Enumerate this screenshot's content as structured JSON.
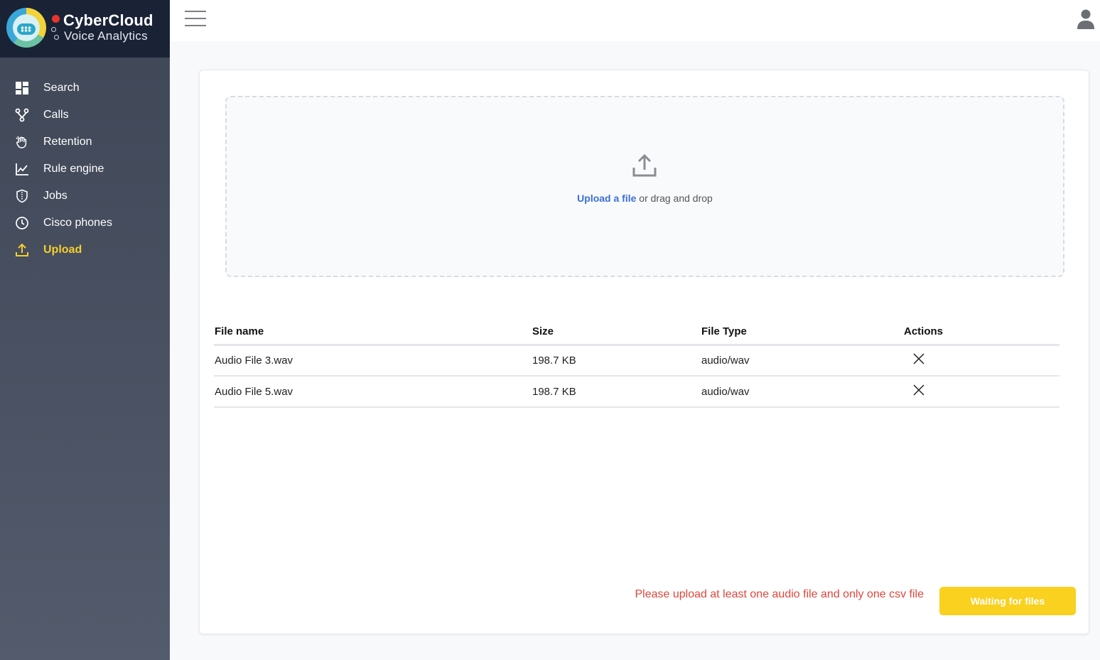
{
  "brand": {
    "title": "CyberCloud",
    "subtitle": "Voice Analytics"
  },
  "nav": [
    {
      "label": "Search",
      "icon": "dashboard-icon",
      "active": false
    },
    {
      "label": "Calls",
      "icon": "branch-icon",
      "active": false
    },
    {
      "label": "Retention",
      "icon": "hand-icon",
      "active": false
    },
    {
      "label": "Rule engine",
      "icon": "chart-line-icon",
      "active": false
    },
    {
      "label": "Jobs",
      "icon": "shield-icon",
      "active": false
    },
    {
      "label": "Cisco phones",
      "icon": "clock-icon",
      "active": false
    },
    {
      "label": "Upload",
      "icon": "upload-icon",
      "active": true
    }
  ],
  "colors": {
    "accent": "#f5cf2a",
    "link": "#3b6fd8",
    "error": "#e0463c",
    "button": "#f9d11e",
    "sidebar_top": "#1a2236"
  },
  "dropzone": {
    "link_text": "Upload a file",
    "rest_text": " or drag and drop"
  },
  "table": {
    "headers": [
      "File name",
      "Size",
      "File Type",
      "Actions"
    ],
    "rows": [
      {
        "name": "Audio File 3.wav",
        "size": "198.7 KB",
        "type": "audio/wav"
      },
      {
        "name": "Audio File 5.wav",
        "size": "198.7 KB",
        "type": "audio/wav"
      }
    ]
  },
  "footer": {
    "error": "Please upload at least one audio file and only one csv file",
    "button": "Waiting for files"
  }
}
